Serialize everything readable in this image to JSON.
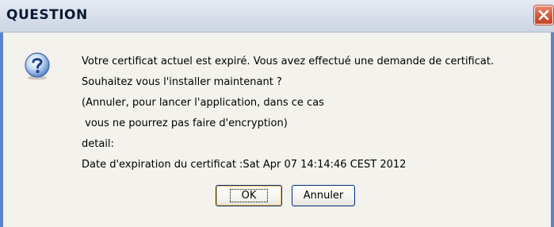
{
  "dialog": {
    "title": "QUESTION",
    "message_lines": [
      "Votre certificat actuel est expiré. Vous avez effectué une demande de certificat.",
      "Souhaitez vous l'installer maintenant ?",
      "(Annuler, pour lancer l'application, dans ce cas",
      " vous ne pourrez pas faire d'encryption)",
      "detail:",
      "Date d'expiration du certificat :Sat Apr 07 14:14:46 CEST 2012"
    ],
    "buttons": {
      "ok_label": "OK",
      "cancel_label": "Annuler"
    },
    "icon": "question-icon",
    "close_icon": "close-icon"
  },
  "colors": {
    "titlebar": "#d6dde9",
    "frame": "#5d84c8",
    "client_bg": "#f3f2ec",
    "close_button": "#d65a3a"
  }
}
